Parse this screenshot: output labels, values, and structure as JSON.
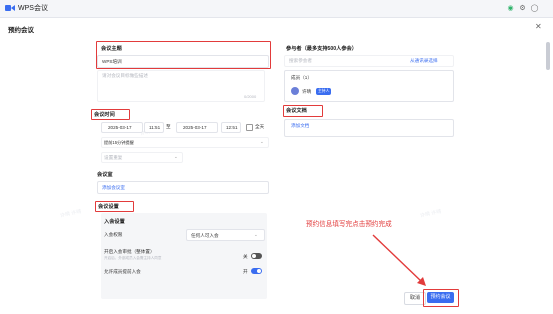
{
  "window": {
    "app_title": "WPS会议"
  },
  "dialog": {
    "title": "预约会议"
  },
  "left": {
    "topic_label": "会议主题",
    "topic_value": "WPS培训",
    "description_placeholder": "请对会议目标做些描述",
    "description_count": "0/2000",
    "time_label": "会议时间",
    "start_date": "2025-03-17",
    "start_time": "11:51",
    "to": "至",
    "end_date": "2025-03-17",
    "end_time": "12:51",
    "all_day": "全天",
    "reminder": "提前15分钟提醒",
    "repeat": "设置重复",
    "room_label": "会议室",
    "add_room": "添加会议室",
    "settings_label": "会议设置",
    "join_settings": "入会设置",
    "join_permission_label": "入会权限",
    "join_permission_value": "任何人可入会",
    "enable_lock_label": "开启入会审批（整体置）",
    "enable_lock_sub": "开启后，外部成员入会需主持人同意",
    "lock_state": "关",
    "allow_early_label": "允许成员提前入会",
    "allow_early_state": "开"
  },
  "right": {
    "participants_label": "参与者（最多支持500人参会）",
    "search_placeholder": "搜索参会者",
    "select_from_contacts": "从通讯录选择",
    "members_count": "成员（1）",
    "member_name": "许晴",
    "member_tag": "主持人",
    "docs_label": "会议文档",
    "add_doc": "添加文档"
  },
  "annotation": {
    "text": "预约信息填写完点击预约完成"
  },
  "footer": {
    "cancel": "取消",
    "confirm": "预约会议"
  },
  "colors": {
    "accent": "#3a6df0",
    "annotation_red": "#e23b3b"
  }
}
